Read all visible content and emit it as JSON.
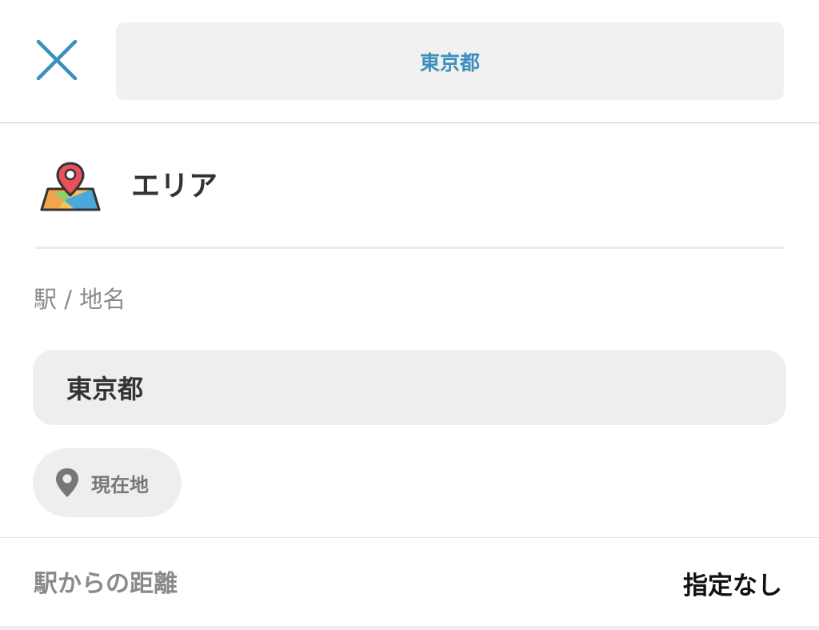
{
  "header": {
    "close_icon": "close-icon",
    "search_value": "東京都"
  },
  "area": {
    "icon": "map-pin-icon",
    "title": "エリア"
  },
  "station": {
    "label": "駅 / 地名",
    "value": "東京都"
  },
  "current_location": {
    "icon": "location-pin-icon",
    "label": "現在地"
  },
  "distance": {
    "label": "駅からの距離",
    "value": "指定なし"
  },
  "colors": {
    "accent": "#3c8fbf",
    "input_bg": "#eeeeee",
    "text_dark": "#333333",
    "text_muted": "#8a8a8a"
  }
}
